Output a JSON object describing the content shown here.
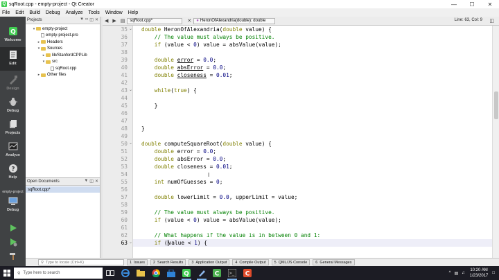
{
  "window": {
    "title": "sqRoot.cpp - empty-project - Qt Creator"
  },
  "menu": [
    "File",
    "Edit",
    "Build",
    "Debug",
    "Analyze",
    "Tools",
    "Window",
    "Help"
  ],
  "modes": [
    {
      "label": "Welcome",
      "icon": "welcome-icon"
    },
    {
      "label": "Edit",
      "icon": "edit-icon"
    },
    {
      "label": "Design",
      "icon": "design-icon"
    },
    {
      "label": "Debug",
      "icon": "debug-icon"
    },
    {
      "label": "Projects",
      "icon": "projects-icon"
    },
    {
      "label": "Analyze",
      "icon": "analyze-icon"
    },
    {
      "label": "Help",
      "icon": "help-icon"
    }
  ],
  "target": {
    "project": "empty-project",
    "config": "Debug"
  },
  "projects_panel": {
    "title": "Projects",
    "tree": [
      {
        "label": "empty-project",
        "indent": 1,
        "kind": "project",
        "expanded": true
      },
      {
        "label": "empty-project.pro",
        "indent": 2,
        "kind": "file"
      },
      {
        "label": "Headers",
        "indent": 2,
        "kind": "folder"
      },
      {
        "label": "Sources",
        "indent": 2,
        "kind": "folder",
        "expanded": true
      },
      {
        "label": "lib/StanfordCPPLib",
        "indent": 3,
        "kind": "folder"
      },
      {
        "label": "src",
        "indent": 3,
        "kind": "folder",
        "expanded": true
      },
      {
        "label": "sqRoot.cpp",
        "indent": 4,
        "kind": "file"
      },
      {
        "label": "Other files",
        "indent": 2,
        "kind": "folder"
      }
    ]
  },
  "open_documents": {
    "title": "Open Documents",
    "items": [
      "sqRoot.cpp*"
    ]
  },
  "editor": {
    "file_tab": "sqRoot.cpp*",
    "symbol": "HeronOfAlexandria(double): double",
    "position": "Line: 63, Col: 9",
    "current_line": 63,
    "lines": [
      {
        "n": 35,
        "fold": "open",
        "segs": [
          {
            "t": "double",
            "c": "kw"
          },
          {
            "t": " HeronOfAlexandria("
          },
          {
            "t": "double",
            "c": "kw"
          },
          {
            "t": " value) {"
          }
        ]
      },
      {
        "n": 36,
        "segs": [
          {
            "t": "    "
          },
          {
            "t": "// The value must always be positive.",
            "c": "cm"
          }
        ]
      },
      {
        "n": 37,
        "segs": [
          {
            "t": "    "
          },
          {
            "t": "if",
            "c": "kw"
          },
          {
            "t": " (value < "
          },
          {
            "t": "0",
            "c": "num"
          },
          {
            "t": ") value = absValue(value);"
          }
        ]
      },
      {
        "n": 38,
        "segs": []
      },
      {
        "n": 39,
        "segs": [
          {
            "t": "    "
          },
          {
            "t": "double",
            "c": "kw"
          },
          {
            "t": " "
          },
          {
            "t": "error",
            "c": "ul"
          },
          {
            "t": " = "
          },
          {
            "t": "0.0",
            "c": "num"
          },
          {
            "t": ";"
          }
        ]
      },
      {
        "n": 40,
        "segs": [
          {
            "t": "    "
          },
          {
            "t": "double",
            "c": "kw"
          },
          {
            "t": " "
          },
          {
            "t": "absError",
            "c": "ul"
          },
          {
            "t": " = "
          },
          {
            "t": "0.0",
            "c": "num"
          },
          {
            "t": ";"
          }
        ]
      },
      {
        "n": 41,
        "segs": [
          {
            "t": "    "
          },
          {
            "t": "double",
            "c": "kw"
          },
          {
            "t": " "
          },
          {
            "t": "closeness",
            "c": "ul"
          },
          {
            "t": " = "
          },
          {
            "t": "0.01",
            "c": "num"
          },
          {
            "t": ";"
          }
        ]
      },
      {
        "n": 42,
        "segs": []
      },
      {
        "n": 43,
        "fold": "open",
        "segs": [
          {
            "t": "    "
          },
          {
            "t": "while",
            "c": "kw"
          },
          {
            "t": "("
          },
          {
            "t": "true",
            "c": "kw"
          },
          {
            "t": ") {"
          }
        ]
      },
      {
        "n": 44,
        "segs": []
      },
      {
        "n": 45,
        "segs": [
          {
            "t": "    }"
          }
        ]
      },
      {
        "n": 46,
        "segs": []
      },
      {
        "n": 47,
        "segs": []
      },
      {
        "n": 48,
        "segs": [
          {
            "t": "}"
          }
        ]
      },
      {
        "n": 49,
        "segs": []
      },
      {
        "n": 50,
        "fold": "open",
        "segs": [
          {
            "t": "double",
            "c": "kw"
          },
          {
            "t": " computeSquareRoot("
          },
          {
            "t": "double",
            "c": "kw"
          },
          {
            "t": " value) {"
          }
        ]
      },
      {
        "n": 51,
        "segs": [
          {
            "t": "    "
          },
          {
            "t": "double",
            "c": "kw"
          },
          {
            "t": " error = "
          },
          {
            "t": "0.0",
            "c": "num"
          },
          {
            "t": ";"
          }
        ]
      },
      {
        "n": 52,
        "segs": [
          {
            "t": "    "
          },
          {
            "t": "double",
            "c": "kw"
          },
          {
            "t": " absError = "
          },
          {
            "t": "0.0",
            "c": "num"
          },
          {
            "t": ";"
          }
        ]
      },
      {
        "n": 53,
        "segs": [
          {
            "t": "    "
          },
          {
            "t": "double",
            "c": "kw"
          },
          {
            "t": " closeness = "
          },
          {
            "t": "0.01",
            "c": "num"
          },
          {
            "t": ";"
          }
        ]
      },
      {
        "n": 54,
        "segs": []
      },
      {
        "n": 55,
        "segs": [
          {
            "t": "    "
          },
          {
            "t": "int",
            "c": "kw"
          },
          {
            "t": " numOfGuesses = "
          },
          {
            "t": "0",
            "c": "num"
          },
          {
            "t": ";"
          }
        ]
      },
      {
        "n": 56,
        "segs": []
      },
      {
        "n": 57,
        "segs": [
          {
            "t": "    "
          },
          {
            "t": "double",
            "c": "kw"
          },
          {
            "t": " lowerLimit = "
          },
          {
            "t": "0.0",
            "c": "num"
          },
          {
            "t": ", upperLimit = value;"
          }
        ]
      },
      {
        "n": 58,
        "segs": []
      },
      {
        "n": 59,
        "segs": [
          {
            "t": "    "
          },
          {
            "t": "// The value must always be positive.",
            "c": "cm"
          }
        ]
      },
      {
        "n": 60,
        "segs": [
          {
            "t": "    "
          },
          {
            "t": "if",
            "c": "kw"
          },
          {
            "t": " (value < "
          },
          {
            "t": "0",
            "c": "num"
          },
          {
            "t": ") value = absValue(value);"
          }
        ]
      },
      {
        "n": 61,
        "segs": []
      },
      {
        "n": 62,
        "segs": [
          {
            "t": "    "
          },
          {
            "t": "// What happens if the value is in between 0 and 1:",
            "c": "cm"
          }
        ]
      },
      {
        "n": 63,
        "fold": "open",
        "segs": [
          {
            "t": "    "
          },
          {
            "t": "if",
            "c": "kw"
          },
          {
            "t": " ("
          },
          {
            "t": "|",
            "c": "cursor"
          },
          {
            "t": "value < "
          },
          {
            "t": "1",
            "c": "num"
          },
          {
            "t": ") {"
          }
        ]
      }
    ]
  },
  "statusbar": {
    "locator_placeholder": "Type to locate (Ctrl+K)",
    "tabs": [
      {
        "n": "1",
        "label": "Issues"
      },
      {
        "n": "2",
        "label": "Search Results"
      },
      {
        "n": "3",
        "label": "Application Output"
      },
      {
        "n": "4",
        "label": "Compile Output"
      },
      {
        "n": "5",
        "label": "QML/JS Console"
      },
      {
        "n": "6",
        "label": "General Messages"
      }
    ]
  },
  "taskbar": {
    "search_placeholder": "Type here to search",
    "apps": [
      "task-view-icon",
      "edge-icon",
      "explorer-icon",
      "chrome-icon",
      "store-icon",
      "qt-creator-icon",
      "pen-icon",
      "camtasia-icon",
      "terminal-icon",
      "recorder-icon"
    ],
    "time": "10:20 AM",
    "date": "1/23/2017"
  },
  "colors": {
    "accent": "#41cd52",
    "modebar": "#404244",
    "keyword": "#808000",
    "comment": "#008000",
    "number": "#000080"
  }
}
